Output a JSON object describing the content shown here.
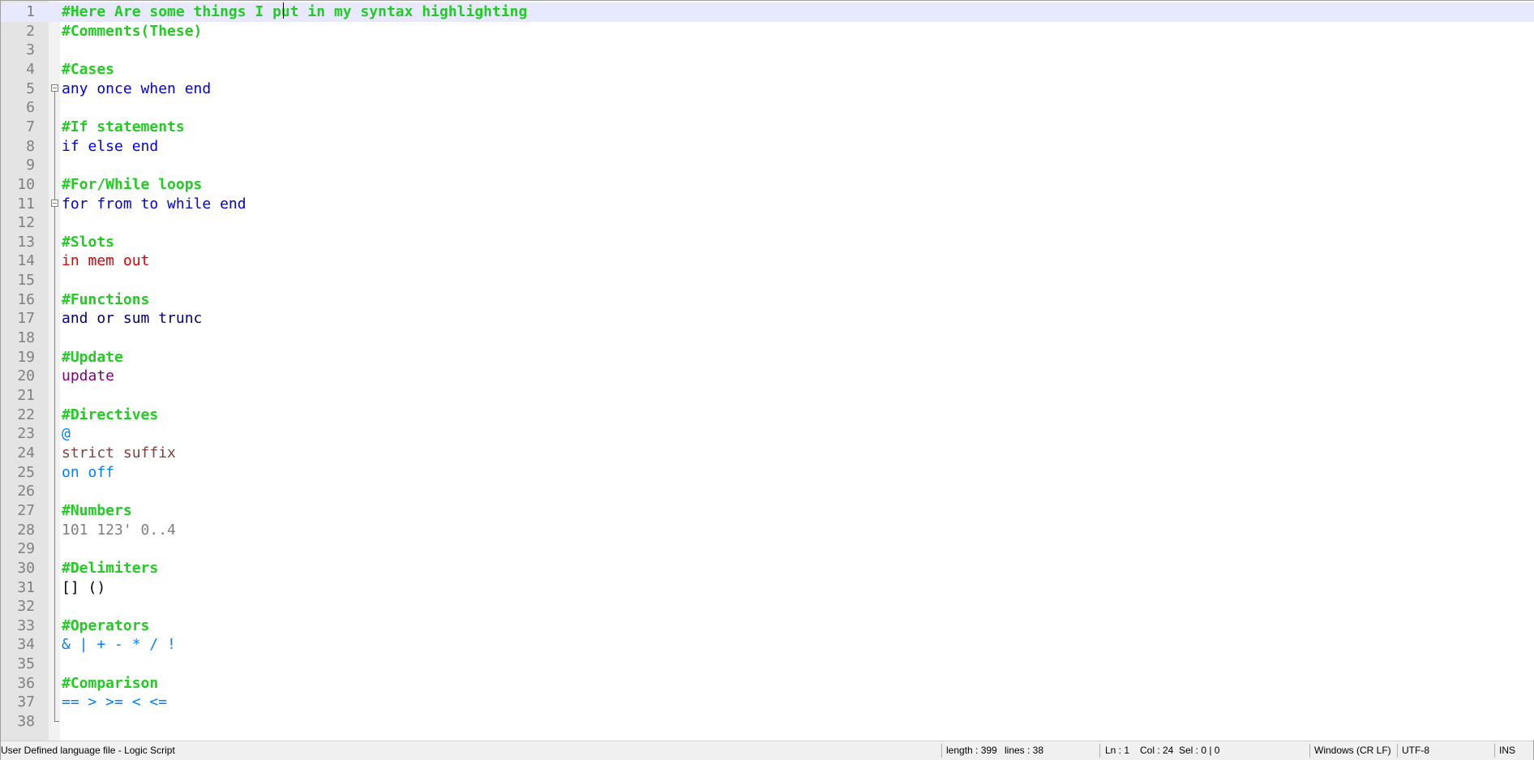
{
  "editor": {
    "lines": [
      {
        "n": "1",
        "tokens": [
          {
            "t": "#Here Are some things I put in my syntax highlighting",
            "c": "comment"
          }
        ]
      },
      {
        "n": "2",
        "tokens": [
          {
            "t": "#Comments(These)",
            "c": "comment"
          }
        ]
      },
      {
        "n": "3",
        "tokens": []
      },
      {
        "n": "4",
        "tokens": [
          {
            "t": "#Cases",
            "c": "comment"
          }
        ]
      },
      {
        "n": "5",
        "tokens": [
          {
            "t": "any once when end",
            "c": "kw-blue"
          }
        ]
      },
      {
        "n": "6",
        "tokens": []
      },
      {
        "n": "7",
        "tokens": [
          {
            "t": "#If statements",
            "c": "comment"
          }
        ]
      },
      {
        "n": "8",
        "tokens": [
          {
            "t": "if else end",
            "c": "kw-blue"
          }
        ]
      },
      {
        "n": "9",
        "tokens": []
      },
      {
        "n": "10",
        "tokens": [
          {
            "t": "#For/While loops",
            "c": "comment"
          }
        ]
      },
      {
        "n": "11",
        "tokens": [
          {
            "t": "for from to while end",
            "c": "kw-blue"
          }
        ]
      },
      {
        "n": "12",
        "tokens": []
      },
      {
        "n": "13",
        "tokens": [
          {
            "t": "#Slots",
            "c": "comment"
          }
        ]
      },
      {
        "n": "14",
        "tokens": [
          {
            "t": "in mem out",
            "c": "kw-red"
          }
        ]
      },
      {
        "n": "15",
        "tokens": []
      },
      {
        "n": "16",
        "tokens": [
          {
            "t": "#Functions",
            "c": "comment"
          }
        ]
      },
      {
        "n": "17",
        "tokens": [
          {
            "t": "and or sum trunc",
            "c": "kw-navy"
          }
        ]
      },
      {
        "n": "18",
        "tokens": []
      },
      {
        "n": "19",
        "tokens": [
          {
            "t": "#Update",
            "c": "comment"
          }
        ]
      },
      {
        "n": "20",
        "tokens": [
          {
            "t": "update",
            "c": "kw-purple"
          }
        ]
      },
      {
        "n": "21",
        "tokens": []
      },
      {
        "n": "22",
        "tokens": [
          {
            "t": "#Directives",
            "c": "comment"
          }
        ]
      },
      {
        "n": "23",
        "tokens": [
          {
            "t": "@",
            "c": "kw-azure"
          }
        ]
      },
      {
        "n": "24",
        "tokens": [
          {
            "t": "strict suffix",
            "c": "kw-brown"
          }
        ]
      },
      {
        "n": "25",
        "tokens": [
          {
            "t": "on off",
            "c": "kw-azure"
          }
        ]
      },
      {
        "n": "26",
        "tokens": []
      },
      {
        "n": "27",
        "tokens": [
          {
            "t": "#Numbers",
            "c": "comment"
          }
        ]
      },
      {
        "n": "28",
        "tokens": [
          {
            "t": "101 123' 0..4",
            "c": "num"
          }
        ]
      },
      {
        "n": "29",
        "tokens": []
      },
      {
        "n": "30",
        "tokens": [
          {
            "t": "#Delimiters",
            "c": "comment"
          }
        ]
      },
      {
        "n": "31",
        "tokens": [
          {
            "t": "[] ()",
            "c": "delim"
          }
        ]
      },
      {
        "n": "32",
        "tokens": []
      },
      {
        "n": "33",
        "tokens": [
          {
            "t": "#Operators",
            "c": "comment"
          }
        ]
      },
      {
        "n": "34",
        "tokens": [
          {
            "t": "& | + - * / !",
            "c": "op"
          }
        ]
      },
      {
        "n": "35",
        "tokens": []
      },
      {
        "n": "36",
        "tokens": [
          {
            "t": "#Comparison",
            "c": "comment"
          }
        ]
      },
      {
        "n": "37",
        "tokens": [
          {
            "t": "== > >= < <=",
            "c": "op"
          }
        ]
      },
      {
        "n": "38",
        "tokens": []
      }
    ],
    "colors": {
      "comment": "#22cc22",
      "keyword": "#0000e0",
      "slot": "#e00000",
      "function": "#000080",
      "update": "#800080",
      "directive": "#0080ff",
      "directive_word": "#804040",
      "number": "#808080",
      "current_line": "#e8e8ff"
    }
  },
  "statusbar": {
    "language": "User Defined language file - Logic Script",
    "length": "length : 399",
    "lines": "lines : 38",
    "ln": "Ln : 1",
    "col": "Col : 24",
    "sel": "Sel : 0 | 0",
    "eol": "Windows (CR LF)",
    "encoding": "UTF-8",
    "mode": "INS"
  }
}
